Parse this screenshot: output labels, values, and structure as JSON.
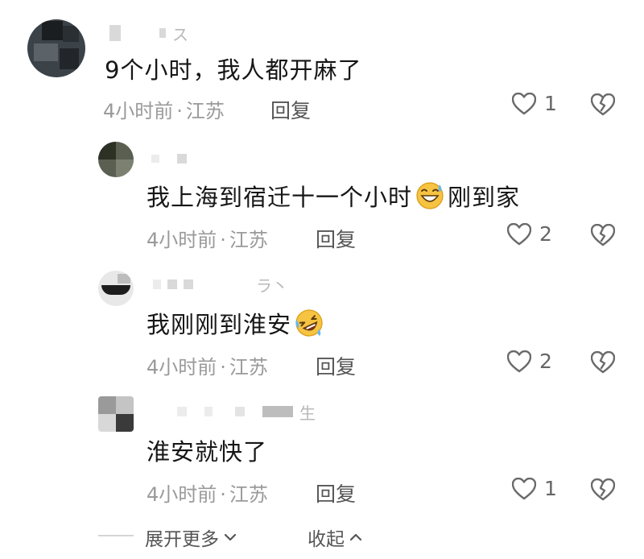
{
  "comments": [
    {
      "name_tail": "ス",
      "text": "9个小时，我人都开麻了",
      "time": "4小时前",
      "location": "江苏",
      "reply_label": "回复",
      "likes": "1"
    },
    {
      "name_tail": "",
      "text_before": "我上海到宿迁十一个小时",
      "emoji": "grinning-sweat-emoji",
      "text_after": "刚到家",
      "time": "4小时前",
      "location": "江苏",
      "reply_label": "回复",
      "likes": "2"
    },
    {
      "name_tail": "ラ丶",
      "text_before": "我刚刚到淮安",
      "emoji": "rolling-laughing-emoji",
      "text_after": "",
      "time": "4小时前",
      "location": "江苏",
      "reply_label": "回复",
      "likes": "2"
    },
    {
      "name_tail": "生",
      "text": "淮安就快了",
      "time": "4小时前",
      "location": "江苏",
      "reply_label": "回复",
      "likes": "1"
    }
  ],
  "footer": {
    "expand_label": "展开更多",
    "collapse_label": "收起"
  },
  "colors": {
    "text": "#161616",
    "meta": "#9a9a9a",
    "icon": "#6a6a6a"
  }
}
